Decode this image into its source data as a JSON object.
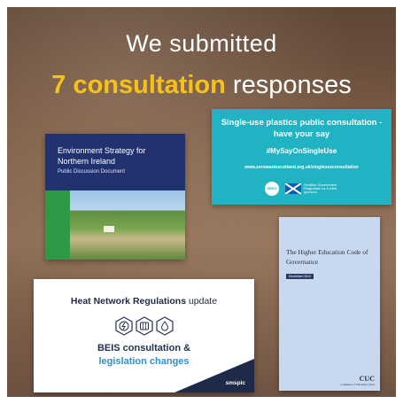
{
  "headline": {
    "line1": "We submitted",
    "highlight": "7 consultation",
    "rest": "responses",
    "highlight_color": "#f7c217"
  },
  "env_doc": {
    "title": "Environment Strategy for Northern Ireland",
    "subtitle": "Public Discussion Document"
  },
  "plastics_doc": {
    "title": "Single-use plastics public consultation - have your say",
    "hashtag": "#MySayOnSingleUse",
    "url": "www.zerowastescotland.org.uk/singleuseconsultation",
    "logo_left": "ZERO WASTE",
    "logo_right": "Scottish Government Riaghaltas na h-Alba gov.scot"
  },
  "he_doc": {
    "title": "The Higher Education Code of Governance",
    "tag": "December 2014",
    "logo": "CUC",
    "logo_sub": "Committee of University Chairs"
  },
  "heat_doc": {
    "title_bold": "Heat Network Regulations",
    "title_rest": " update",
    "line1": "BEIS consultation &",
    "line2": "legislation changes",
    "brand": "smspic",
    "icons": [
      "electricity-icon",
      "heating-icon",
      "water-drop-icon"
    ]
  }
}
